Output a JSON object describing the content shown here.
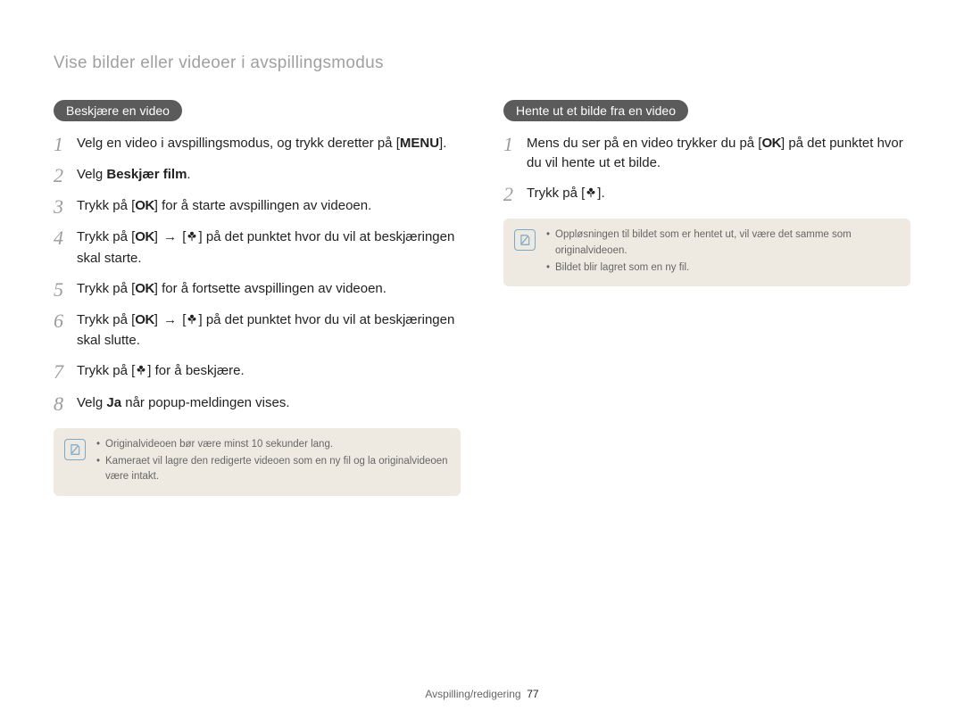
{
  "page": {
    "title": "Vise bilder eller videoer i avspillingsmodus",
    "footer_section": "Avspilling/redigering",
    "footer_page": "77"
  },
  "icons": {
    "ok": "OK",
    "arrow": "→"
  },
  "left": {
    "heading": "Beskjære en video",
    "steps": {
      "s1_a": "Velg en video i avspillingsmodus, og trykk deretter på [",
      "s1_menu": "MENU",
      "s1_b": "].",
      "s2_a": "Velg ",
      "s2_bold": "Beskjær film",
      "s2_b": ".",
      "s3_a": "Trykk på [",
      "s3_b": "] for å starte avspillingen av videoen.",
      "s4_a": "Trykk på [",
      "s4_b": "] ",
      "s4_c": " [",
      "s4_d": "] på det punktet hvor du vil at beskjæringen skal starte.",
      "s5_a": "Trykk på [",
      "s5_b": "] for å fortsette avspillingen av videoen.",
      "s6_a": "Trykk på [",
      "s6_b": "] ",
      "s6_c": " [",
      "s6_d": "] på det punktet hvor du vil at beskjæringen skal slutte.",
      "s7_a": "Trykk på [",
      "s7_b": "] for å beskjære.",
      "s8_a": "Velg ",
      "s8_bold": "Ja",
      "s8_b": " når popup-meldingen vises."
    },
    "note": {
      "n1": "Originalvideoen bør være minst 10 sekunder lang.",
      "n2": "Kameraet vil lagre den redigerte videoen som en ny fil og la originalvideoen være intakt."
    }
  },
  "right": {
    "heading": "Hente ut et bilde fra en video",
    "steps": {
      "s1_a": "Mens du ser på en video trykker du på [",
      "s1_b": "] på det punktet hvor du vil hente ut et bilde.",
      "s2_a": "Trykk på [",
      "s2_b": "]."
    },
    "note": {
      "n1": "Oppløsningen til bildet som er hentet ut, vil være det samme som originalvideoen.",
      "n2": "Bildet blir lagret som en ny fil."
    }
  }
}
